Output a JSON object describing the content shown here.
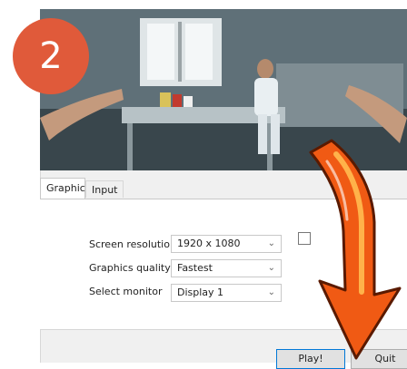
{
  "step_number": "2",
  "tabs": [
    {
      "label": "Graphics"
    },
    {
      "label": "Input"
    }
  ],
  "settings": {
    "screen_resolution": {
      "label": "Screen resolution",
      "value": "1920 x 1080"
    },
    "graphics_quality": {
      "label": "Graphics quality",
      "value": "Fastest"
    },
    "select_monitor": {
      "label": "Select monitor",
      "value": "Display 1"
    }
  },
  "buttons": {
    "play": "Play!",
    "quit": "Quit"
  },
  "colors": {
    "badge": "#e05a3a",
    "arrow": "#f05a14"
  }
}
